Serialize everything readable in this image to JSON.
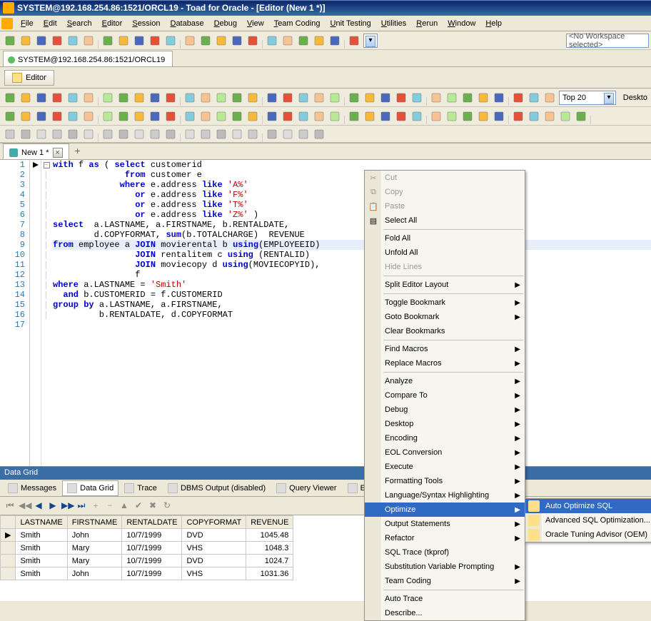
{
  "title": "SYSTEM@192.168.254.86:1521/ORCL19 - Toad for Oracle - [Editor (New 1 *)]",
  "menus": [
    "File",
    "Edit",
    "Search",
    "Editor",
    "Session",
    "Database",
    "Debug",
    "View",
    "Team Coding",
    "Unit Testing",
    "Utilities",
    "Rerun",
    "Window",
    "Help"
  ],
  "workspace_combo": "<No Workspace selected>",
  "conn_tab": "SYSTEM@192.168.254.86:1521/ORCL19",
  "editor_button": "Editor",
  "top_combo": "Top 20",
  "desktop_label": "Deskto",
  "file_tab": "New 1 *",
  "code": {
    "lines": [
      {
        "n": 1,
        "t": "with f as ( select customerid",
        "hl": false
      },
      {
        "n": 2,
        "t": "              from customer e",
        "hl": false
      },
      {
        "n": 3,
        "t": "             where e.address like 'A%'",
        "hl": false
      },
      {
        "n": 4,
        "t": "                or e.address like 'F%'",
        "hl": false
      },
      {
        "n": 5,
        "t": "                or e.address like 'T%'",
        "hl": false
      },
      {
        "n": 6,
        "t": "                or e.address like 'Z%' )",
        "hl": false
      },
      {
        "n": 7,
        "t": "select  a.LASTNAME, a.FIRSTNAME, b.RENTALDATE,",
        "hl": false
      },
      {
        "n": 8,
        "t": "        d.COPYFORMAT, sum(b.TOTALCHARGE)  REVENUE",
        "hl": false
      },
      {
        "n": 9,
        "t": "from employee a JOIN movierental b using(EMPLOYEEID) ",
        "hl": true
      },
      {
        "n": 10,
        "t": "                JOIN rentalitem c using (RENTALID)",
        "hl": false
      },
      {
        "n": 11,
        "t": "                JOIN moviecopy d using(MOVIECOPYID),",
        "hl": false
      },
      {
        "n": 12,
        "t": "                f",
        "hl": false
      },
      {
        "n": 13,
        "t": "where a.LASTNAME = 'Smith'",
        "hl": false
      },
      {
        "n": 14,
        "t": "  and b.CUSTOMERID = f.CUSTOMERID",
        "hl": false
      },
      {
        "n": 15,
        "t": "group by a.LASTNAME, a.FIRSTNAME,",
        "hl": false
      },
      {
        "n": 16,
        "t": "         b.RENTALDATE, d.COPYFORMAT",
        "hl": false
      },
      {
        "n": 17,
        "t": "",
        "hl": false
      }
    ]
  },
  "datagrid_title": "Data Grid",
  "grid_tabs": [
    "Messages",
    "Data Grid",
    "Trace",
    "DBMS Output (disabled)",
    "Query Viewer",
    "Expl"
  ],
  "grid": {
    "cols": [
      "LASTNAME",
      "FIRSTNAME",
      "RENTALDATE",
      "COPYFORMAT",
      "REVENUE"
    ],
    "rows": [
      {
        "LASTNAME": "Smith",
        "FIRSTNAME": "John",
        "RENTALDATE": "10/7/1999",
        "COPYFORMAT": "DVD",
        "REVENUE": "1045.48",
        "cur": true
      },
      {
        "LASTNAME": "Smith",
        "FIRSTNAME": "Mary",
        "RENTALDATE": "10/7/1999",
        "COPYFORMAT": "VHS",
        "REVENUE": "1048.3",
        "cur": false
      },
      {
        "LASTNAME": "Smith",
        "FIRSTNAME": "Mary",
        "RENTALDATE": "10/7/1999",
        "COPYFORMAT": "DVD",
        "REVENUE": "1024.7",
        "cur": false
      },
      {
        "LASTNAME": "Smith",
        "FIRSTNAME": "John",
        "RENTALDATE": "10/7/1999",
        "COPYFORMAT": "VHS",
        "REVENUE": "1031.36",
        "cur": false
      }
    ]
  },
  "ctx": {
    "items": [
      {
        "label": "Cut",
        "icon": "✂",
        "disabled": true
      },
      {
        "label": "Copy",
        "icon": "⧉",
        "disabled": true
      },
      {
        "label": "Paste",
        "icon": "📋",
        "disabled": true
      },
      {
        "label": "Select All",
        "icon": "▤",
        "disabled": false
      },
      {
        "div": true
      },
      {
        "label": "Fold All"
      },
      {
        "label": "Unfold All"
      },
      {
        "label": "Hide Lines",
        "disabled": true
      },
      {
        "div": true
      },
      {
        "label": "Split Editor Layout",
        "sub": true
      },
      {
        "div": true
      },
      {
        "label": "Toggle Bookmark",
        "sub": true
      },
      {
        "label": "Goto Bookmark",
        "sub": true
      },
      {
        "label": "Clear Bookmarks"
      },
      {
        "div": true
      },
      {
        "label": "Find Macros",
        "sub": true
      },
      {
        "label": "Replace Macros",
        "sub": true
      },
      {
        "div": true
      },
      {
        "label": "Analyze",
        "sub": true
      },
      {
        "label": "Compare To",
        "sub": true
      },
      {
        "label": "Debug",
        "sub": true
      },
      {
        "label": "Desktop",
        "sub": true
      },
      {
        "label": "Encoding",
        "sub": true
      },
      {
        "label": "EOL Conversion",
        "sub": true
      },
      {
        "label": "Execute",
        "sub": true
      },
      {
        "label": "Formatting Tools",
        "sub": true
      },
      {
        "label": "Language/Syntax Highlighting",
        "sub": true
      },
      {
        "label": "Optimize",
        "sub": true,
        "sel": true
      },
      {
        "label": "Output Statements",
        "sub": true
      },
      {
        "label": "Refactor",
        "sub": true
      },
      {
        "label": "SQL Trace (tkprof)"
      },
      {
        "label": "Substitution Variable Prompting",
        "sub": true
      },
      {
        "label": "Team Coding",
        "sub": true
      },
      {
        "div": true
      },
      {
        "label": "Auto Trace"
      },
      {
        "label": "Describe..."
      }
    ]
  },
  "submenu": [
    {
      "label": "Auto Optimize SQL",
      "sel": true
    },
    {
      "label": "Advanced SQL Optimization..."
    },
    {
      "label": "Oracle Tuning Advisor (OEM)"
    }
  ]
}
